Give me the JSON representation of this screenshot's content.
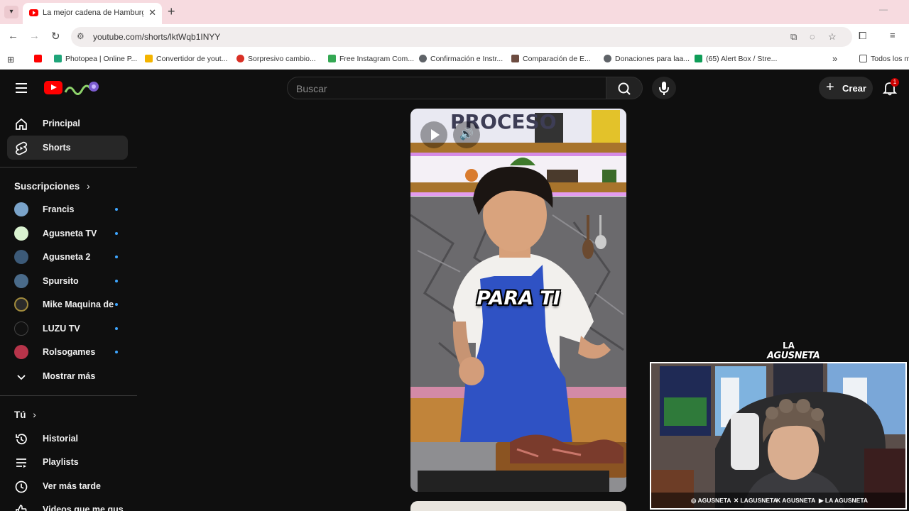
{
  "browser": {
    "tab_title": "La mejor cadena de Hamburguesas",
    "tab_close": "✕",
    "new_tab": "+",
    "url": "youtube.com/shorts/lktWqb1INYY",
    "bookmarks": [
      {
        "label": "",
        "color": "#ff0000"
      },
      {
        "label": "Photopea | Online P...",
        "color": "#1fa57a"
      },
      {
        "label": "Convertidor de yout...",
        "color": "#f4b400"
      },
      {
        "label": "Sorpresivo cambio...",
        "color": "#d93025"
      },
      {
        "label": "Free Instagram Com...",
        "color": "#34a853"
      },
      {
        "label": "Confirmación e Instr...",
        "color": "#5f6368"
      },
      {
        "label": "Comparación de E...",
        "color": "#6d4c41"
      },
      {
        "label": "Donaciones para laa...",
        "color": "#5f6368"
      },
      {
        "label": "(65) Alert Box / Stre...",
        "color": "#0f9d58"
      }
    ],
    "bookmarks_more": "»",
    "all_bookmarks": "Todos los m"
  },
  "youtube": {
    "search_placeholder": "Buscar",
    "create_label": "Crear",
    "notification_count": "1",
    "nav": [
      {
        "label": "Principal",
        "icon": "home-icon"
      },
      {
        "label": "Shorts",
        "icon": "shorts-icon",
        "active": true
      }
    ],
    "subscriptions_title": "Suscripciones",
    "subscriptions": [
      {
        "name": "Francis",
        "avatar_color": "#7aa3c9"
      },
      {
        "name": "Agusneta TV",
        "avatar_color": "#d9f2d0"
      },
      {
        "name": "Agusneta 2",
        "avatar_color": "#3c5a78"
      },
      {
        "name": "Spursito",
        "avatar_color": "#4a6b8a"
      },
      {
        "name": "Mike Maquina de...",
        "avatar_color": "#2b2b2b"
      },
      {
        "name": "LUZU TV",
        "avatar_color": "#111111"
      },
      {
        "name": "Rolsogames",
        "avatar_color": "#b7344a"
      }
    ],
    "show_more": "Mostrar más",
    "you_title": "Tú",
    "you_items": [
      {
        "label": "Historial",
        "icon": "history-icon"
      },
      {
        "label": "Playlists",
        "icon": "playlists-icon"
      },
      {
        "label": "Ver más tarde",
        "icon": "watch-later-icon"
      },
      {
        "label": "Videos que me gus",
        "icon": "like-icon"
      }
    ]
  },
  "short": {
    "caption": "PARA TI",
    "sign_text": "PROCESO"
  },
  "stream_overlay": {
    "logo_top": "LA",
    "logo_main": "AGUSNETA",
    "socials": [
      "AGUSNETA",
      "LAGUSNETA",
      "AGUSNETA",
      "LA AGUSNETA"
    ]
  }
}
